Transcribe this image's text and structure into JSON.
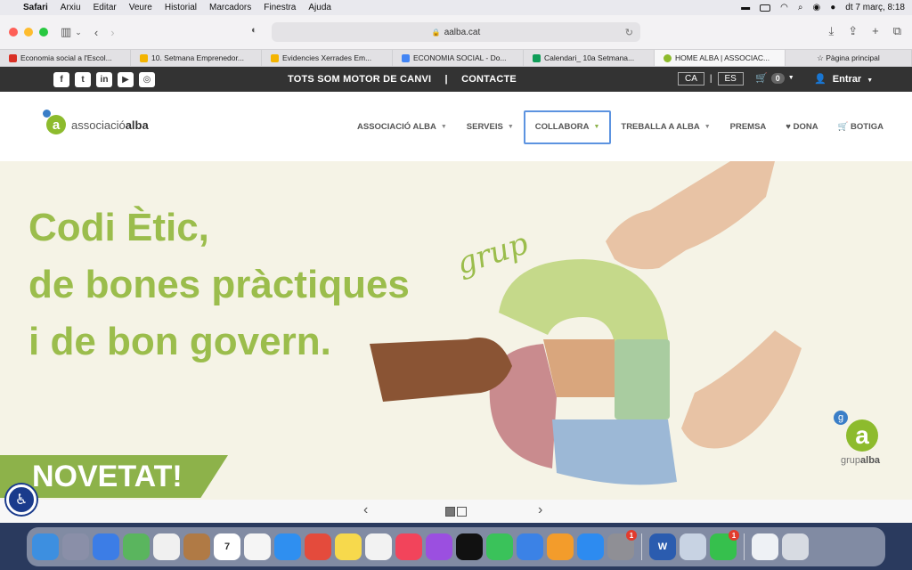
{
  "menubar": {
    "app": "Safari",
    "items": [
      "Arxiu",
      "Editar",
      "Veure",
      "Historial",
      "Marcadors",
      "Finestra",
      "Ajuda"
    ],
    "clock": "dt 7 març, 8:18"
  },
  "browser": {
    "url": "aalba.cat",
    "tabs": [
      {
        "label": "Economia social a l'Escol...",
        "color": "#d93025"
      },
      {
        "label": "10. Setmana Emprenedor...",
        "color": "#f4b400"
      },
      {
        "label": "Evidencies Xerrades Em...",
        "color": "#f4b400"
      },
      {
        "label": "ECONOMIA SOCIAL - Do...",
        "color": "#4285f4"
      },
      {
        "label": "Calendari_ 10a Setmana...",
        "color": "#0f9d58"
      },
      {
        "label": "HOME ALBA | ASSOCIAC...",
        "color": "#8dbb2d"
      },
      {
        "label": "☆ Pàgina principal",
        "color": ""
      }
    ]
  },
  "site": {
    "topbar": {
      "social": [
        "f",
        "t",
        "in",
        "▶",
        "◎"
      ],
      "motto": "TOTS SOM MOTOR DE CANVI",
      "separator": "|",
      "contact": "CONTACTE",
      "lang_ca": "CA",
      "lang_es": "ES",
      "cart_count": "0",
      "login": "Entrar"
    },
    "logo_text_light": "associació",
    "logo_text_bold": "alba",
    "nav": [
      {
        "label": "ASSOCIACIÓ ALBA",
        "caret": true
      },
      {
        "label": "SERVEIS",
        "caret": true
      },
      {
        "label": "COLLABORA",
        "caret": true
      },
      {
        "label": "TREBALLA A ALBA",
        "caret": true
      },
      {
        "label": "PREMSA",
        "caret": false
      },
      {
        "label": "♥ DONA",
        "caret": false
      },
      {
        "label": "🛒 BOTIGA",
        "caret": false
      }
    ],
    "hero": {
      "line1": "Codi Ètic,",
      "line2": "de bones pràctiques",
      "line3": "i de bon govern.",
      "badge": "NOVETAT!",
      "script_word": "grup",
      "brand_small": "grup",
      "brand_bold": "alba"
    }
  },
  "colors": {
    "accent_green": "#9bbd4c",
    "nav_focus": "#5c93e0"
  }
}
